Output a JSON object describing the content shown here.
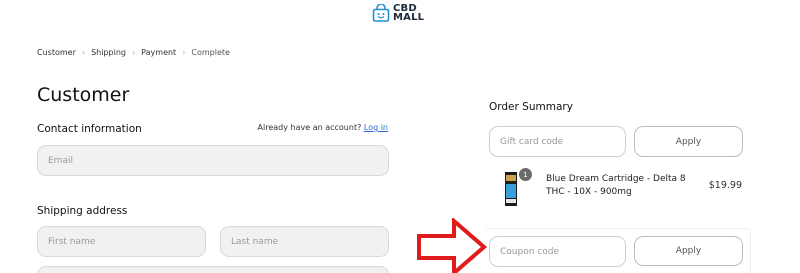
{
  "logo": {
    "line1": "CBD",
    "line2": "MALL"
  },
  "breadcrumb": [
    "Customer",
    "Shipping",
    "Payment",
    "Complete"
  ],
  "page_title": "Customer",
  "contact": {
    "heading": "Contact information",
    "login_prompt": "Already have an account?",
    "login_link": "Log in",
    "email_placeholder": "Email"
  },
  "shipping": {
    "heading": "Shipping address",
    "first_name_placeholder": "First name",
    "last_name_placeholder": "Last name"
  },
  "order_summary": {
    "heading": "Order Summary",
    "gift_card_placeholder": "Gift card code",
    "gift_apply_label": "Apply",
    "item": {
      "quantity": "1",
      "name": "Blue Dream Cartridge - Delta 8 THC - 10X - 900mg",
      "price": "$19.99"
    },
    "coupon_placeholder": "Coupon code",
    "coupon_apply_label": "Apply"
  },
  "colors": {
    "accent_link": "#2b6cd8",
    "annotation_arrow": "#e01b1b",
    "logo_blue": "#1f8fd6"
  }
}
